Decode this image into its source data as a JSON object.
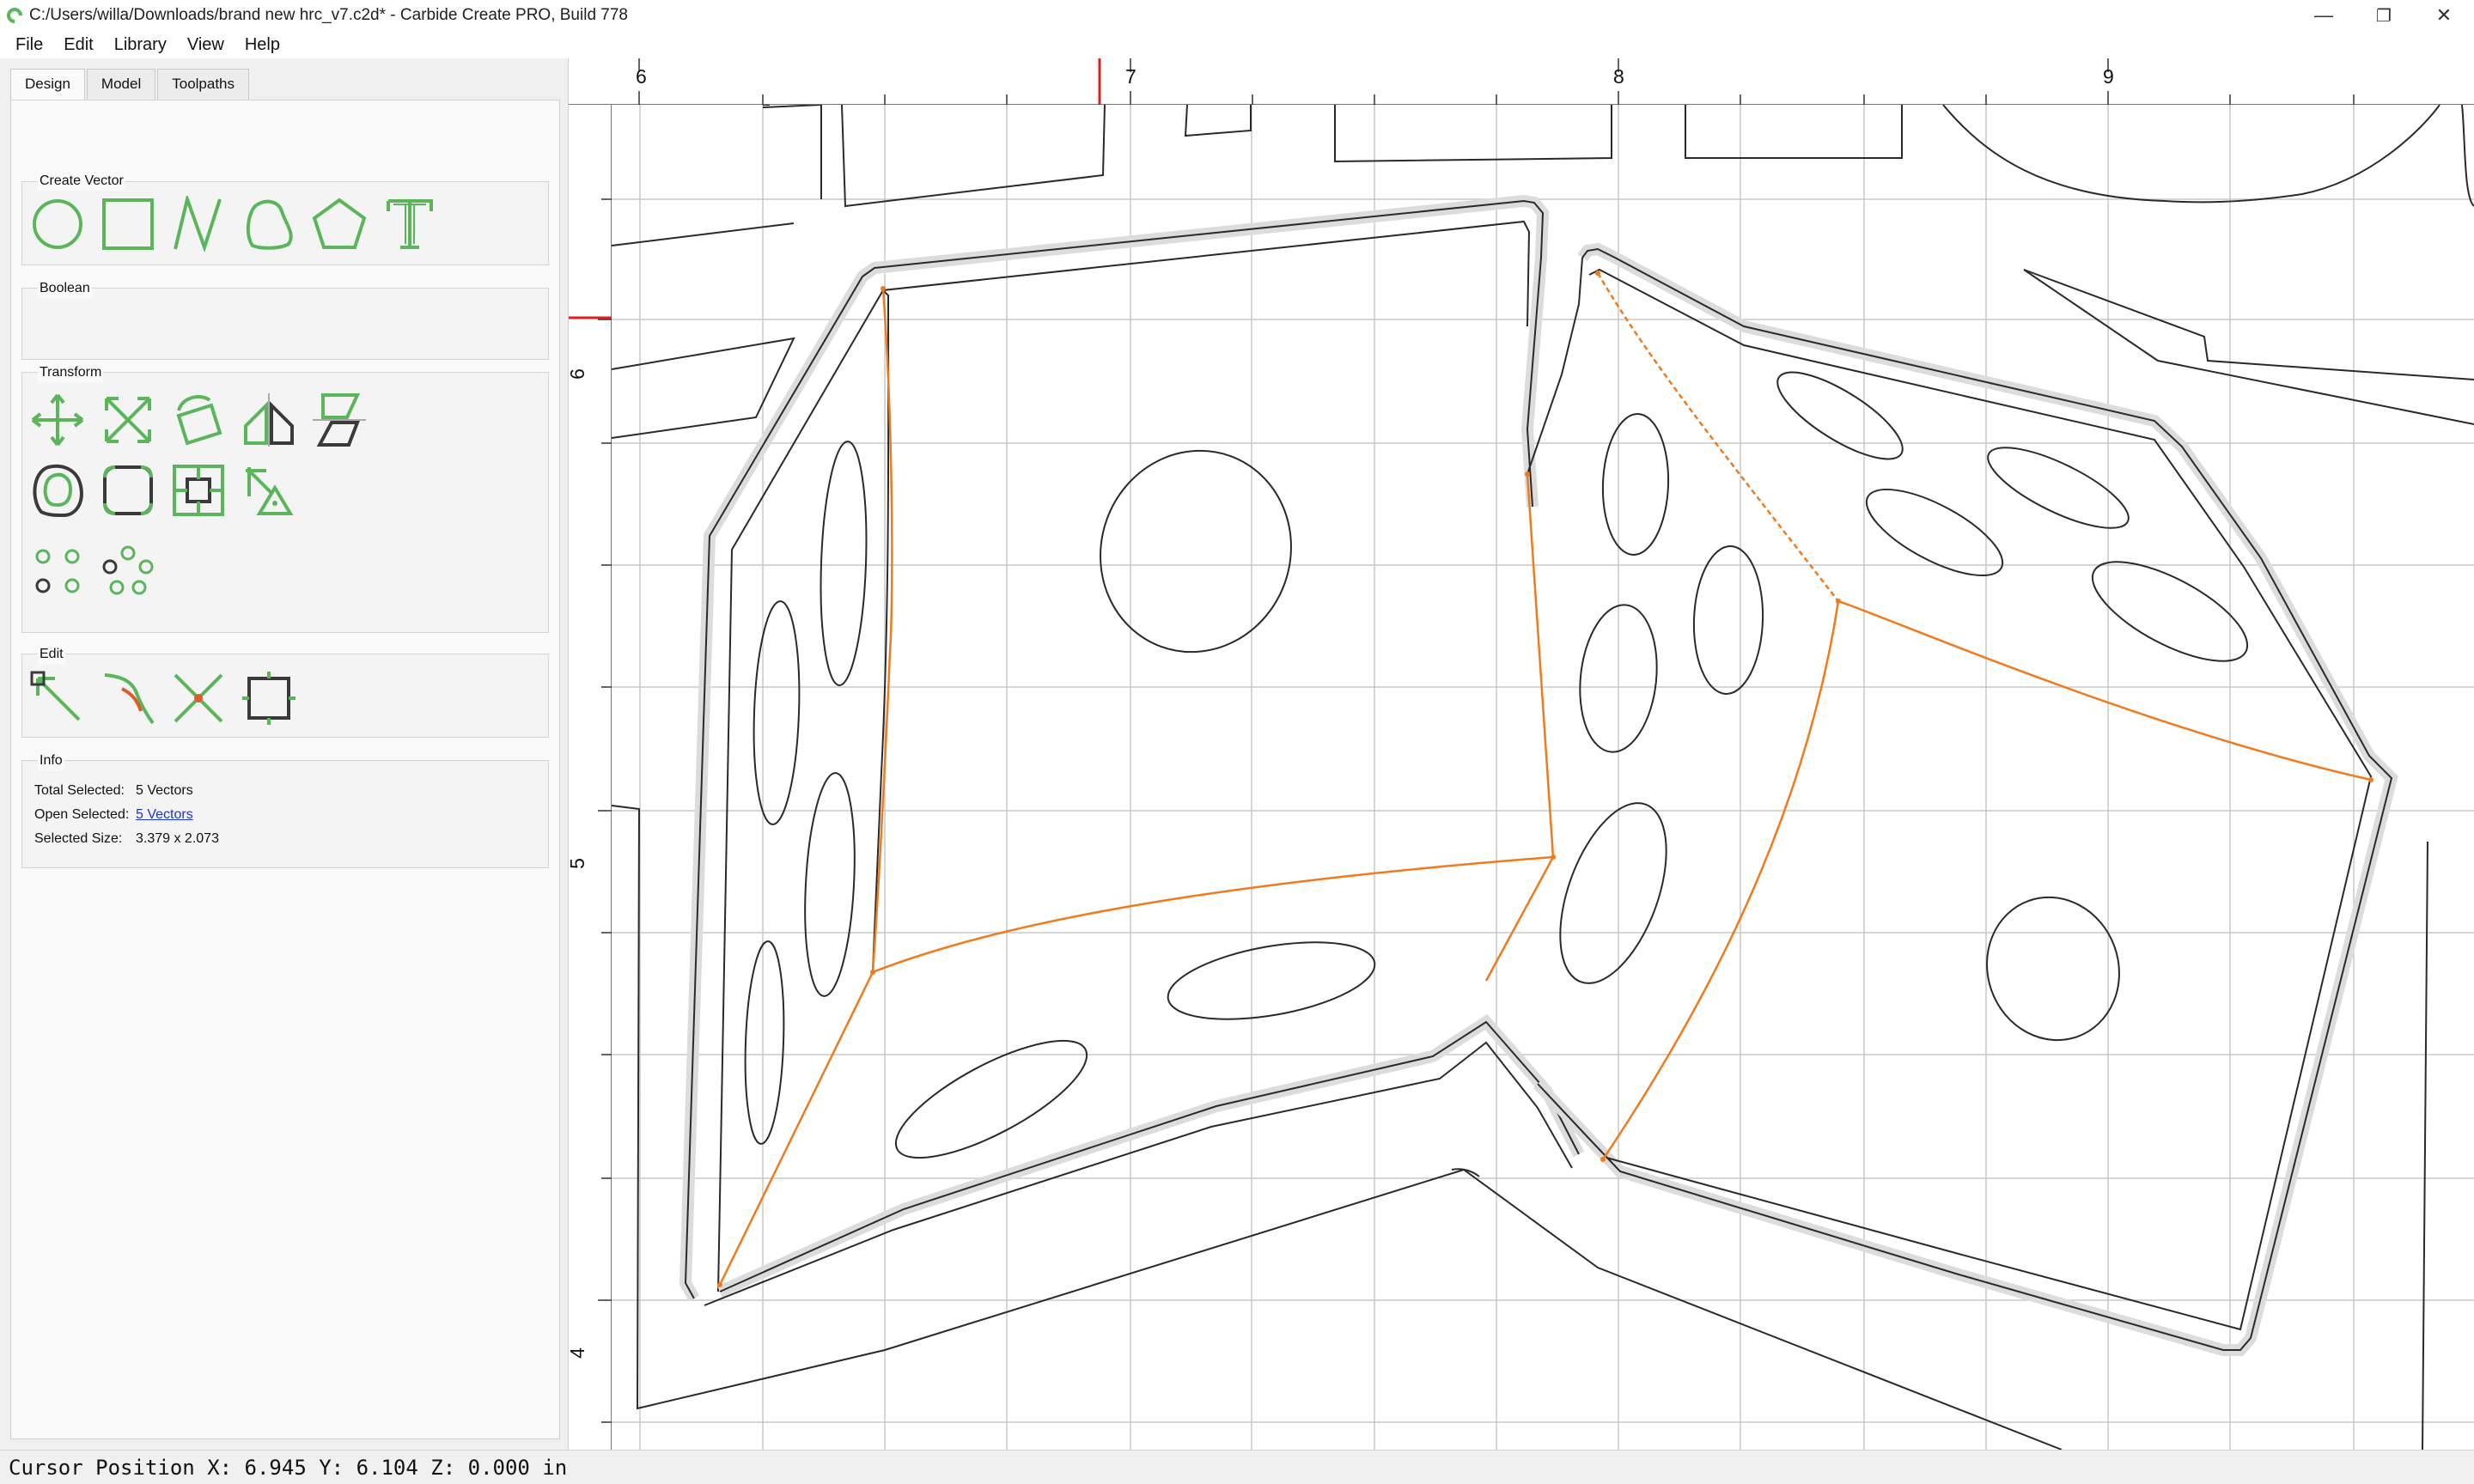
{
  "window": {
    "title": "C:/Users/willa/Downloads/brand new hrc_v7.c2d* - Carbide Create PRO, Build 778",
    "minimize": "—",
    "restore": "❐",
    "close": "✕"
  },
  "menu": [
    {
      "label": "File"
    },
    {
      "label": "Edit"
    },
    {
      "label": "Library"
    },
    {
      "label": "View"
    },
    {
      "label": "Help"
    }
  ],
  "tabs": [
    {
      "label": "Design",
      "active": true
    },
    {
      "label": "Model",
      "active": false
    },
    {
      "label": "Toolpaths",
      "active": false
    }
  ],
  "groups": {
    "create_vector": "Create Vector",
    "boolean": "Boolean",
    "transform": "Transform",
    "edit": "Edit",
    "info": "Info"
  },
  "info": {
    "total_selected_label": "Total Selected:",
    "total_selected_value": "5 Vectors",
    "open_selected_label": "Open Selected:",
    "open_selected_value": "5 Vectors",
    "selected_size_label": "Selected Size:",
    "selected_size_value": "3.379 x 2.073"
  },
  "rulers": {
    "top_labels": [
      "6",
      "7",
      "8",
      "9"
    ],
    "left_labels": [
      "6",
      "5",
      "4"
    ]
  },
  "status": {
    "cursor": "Cursor Position X: 6.945 Y: 6.104 Z: 0.000 in"
  },
  "colors": {
    "accent_green": "#5bb55b",
    "selection_orange": "#f07a1c",
    "cursor_red": "#e0201c",
    "grid": "#c8c8c8"
  },
  "icons": {
    "create_vector": [
      "circle-icon",
      "rectangle-icon",
      "polyline-icon",
      "curve-icon",
      "polygon-icon",
      "text-icon"
    ],
    "transform_row1": [
      "move-icon",
      "scale-icon",
      "rotate-icon",
      "mirror-icon",
      "align-icon"
    ],
    "transform_row2": [
      "offset-icon",
      "fillet-icon",
      "boundary-icon",
      "tab-icon"
    ],
    "transform_row3": [
      "grid-array-icon",
      "circular-array-icon"
    ],
    "edit": [
      "node-edit-icon",
      "join-icon",
      "trim-icon",
      "transform-box-icon"
    ]
  }
}
